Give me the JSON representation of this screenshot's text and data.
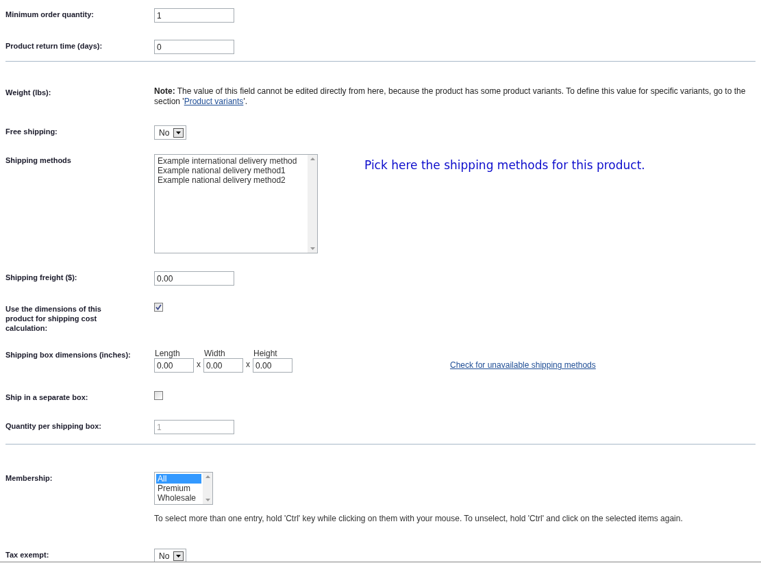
{
  "sections": [
    {
      "rows": [
        {
          "kind": "text",
          "label": "Minimum order quantity:",
          "value": "1",
          "disabled": false
        },
        {
          "kind": "text",
          "label": "Product return time (days):",
          "value": "0",
          "disabled": false
        }
      ]
    },
    {
      "rows": [
        {
          "kind": "note",
          "label": "Weight (lbs):",
          "note": "**Note:** The value of this field cannot be edited directly from here, because the product has some product variants. To define this value for specific variants, go to the section '",
          "link": "Product variants",
          "after": "'."
        },
        {
          "kind": "select",
          "label": "Free shipping:",
          "value": "No"
        },
        {
          "kind": "listbox",
          "label": "Shipping methods",
          "options": [
            {
              "label": "Example international delivery method",
              "selected": false
            },
            {
              "label": "Example national delivery method1",
              "selected": false
            },
            {
              "label": "Example national delivery method2",
              "selected": false
            }
          ],
          "hint": "Pick here the shipping methods for this product."
        },
        {
          "kind": "text",
          "label": "Shipping freight ($):",
          "value": "0.00",
          "disabled": false
        },
        {
          "kind": "checkbox",
          "label": "Use the dimensions of this product for shipping cost calculation:",
          "checked": true
        },
        {
          "kind": "dimensions",
          "label": "Shipping box dimensions (inches):",
          "fields": [
            {
              "label": "Length",
              "value": "0.00"
            },
            {
              "label": "Width",
              "value": "0.00"
            },
            {
              "label": "Height",
              "value": "0.00"
            }
          ],
          "separators": [
            "x",
            "x"
          ],
          "link": "Check for unavailable shipping methods"
        },
        {
          "kind": "checkbox",
          "label": "Ship in a separate box:",
          "checked": false
        },
        {
          "kind": "text",
          "label": "Quantity per shipping box:",
          "value": "1",
          "disabled": true
        }
      ]
    },
    {
      "rows": [
        {
          "kind": "multiselect",
          "label": "Membership:",
          "options": [
            {
              "label": "All",
              "selected": true
            },
            {
              "label": "Premium",
              "selected": false
            },
            {
              "label": "Wholesale",
              "selected": false
            }
          ],
          "help": "To select more than one entry, hold 'Ctrl' key while clicking on them with your mouse. To unselect, hold 'Ctrl' and click on the selected items again."
        },
        {
          "kind": "select",
          "label": "Tax exempt:",
          "value": "No"
        }
      ]
    }
  ]
}
